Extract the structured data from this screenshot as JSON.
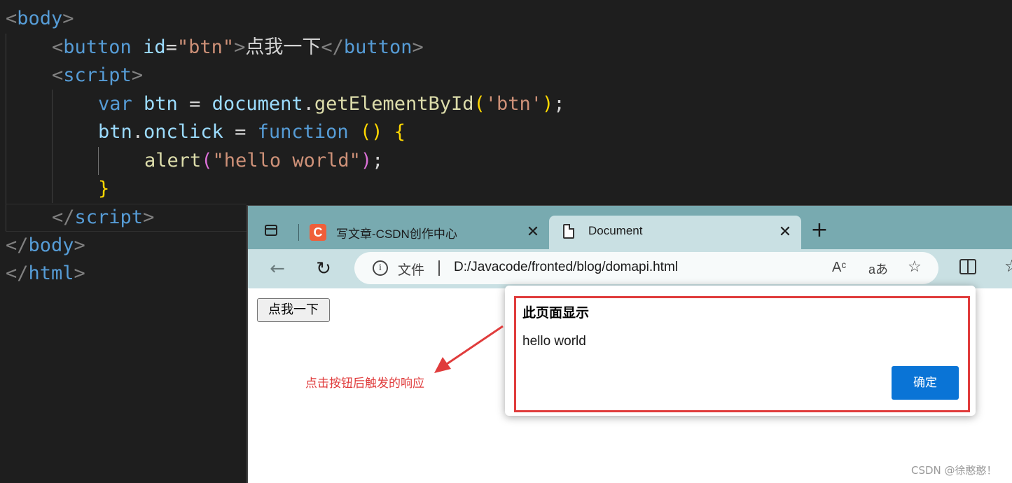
{
  "editor": {
    "lines": {
      "l1": {
        "open": "<",
        "tag": "body",
        "close": ">"
      },
      "l2": {
        "open": "<",
        "tag": "button",
        "attr": "id",
        "eq": "=",
        "val": "\"btn\"",
        "gt": ">",
        "text": "点我一下",
        "close_open": "</",
        "close_tag": "button",
        "close_gt": ">"
      },
      "l3": {
        "open": "<",
        "tag": "script",
        "close": ">"
      },
      "l4": {
        "kw": "var",
        "name": "btn",
        "eq": " = ",
        "obj": "document",
        "dot": ".",
        "fn": "getElementById",
        "p1": "(",
        "arg": "'btn'",
        "p2": ")",
        "semi": ";"
      },
      "l5": {
        "obj": "btn",
        "dot": ".",
        "prop": "onclick",
        "eq": " = ",
        "kw": "function",
        "parens": "()",
        "brace": "{"
      },
      "l6": {
        "fn": "alert",
        "p1": "(",
        "arg": "\"hello world\"",
        "p2": ")",
        "semi": ";"
      },
      "l7": {
        "brace": "}"
      },
      "l8": {
        "open": "</",
        "tag": "script",
        "close": ">"
      },
      "l9": {
        "open": "</",
        "tag": "body",
        "close": ">"
      },
      "l10": {
        "open": "</",
        "tag": "html",
        "close": ">"
      }
    }
  },
  "browser": {
    "tabs": [
      {
        "icon": "C",
        "title": "写文章-CSDN创作中心",
        "close": "✕"
      },
      {
        "title": "Document",
        "close": "✕"
      }
    ],
    "new_tab": "+",
    "toolbar": {
      "back": "←",
      "refresh": "↻",
      "info": "i",
      "file_label": "文件",
      "url": "D:/Javacode/fronted/blog/domapi.html",
      "read_aloud": "Aᶜ",
      "translate": "aあ",
      "favorite": "☆"
    },
    "page": {
      "button_label": "点我一下"
    }
  },
  "dialog": {
    "title": "此页面显示",
    "message": "hello world",
    "ok_label": "确定"
  },
  "annotation": {
    "text": "点击按钮后触发的响应",
    "color": "#e03c3c"
  },
  "watermark": "CSDN @徐憨憨！",
  "colors": {
    "editor_bg": "#1e1e1e",
    "tabbar": "#78aab0",
    "toolbar": "#c9e0e3",
    "ok_button": "#0a74d6",
    "highlight": "#e03c3c"
  }
}
